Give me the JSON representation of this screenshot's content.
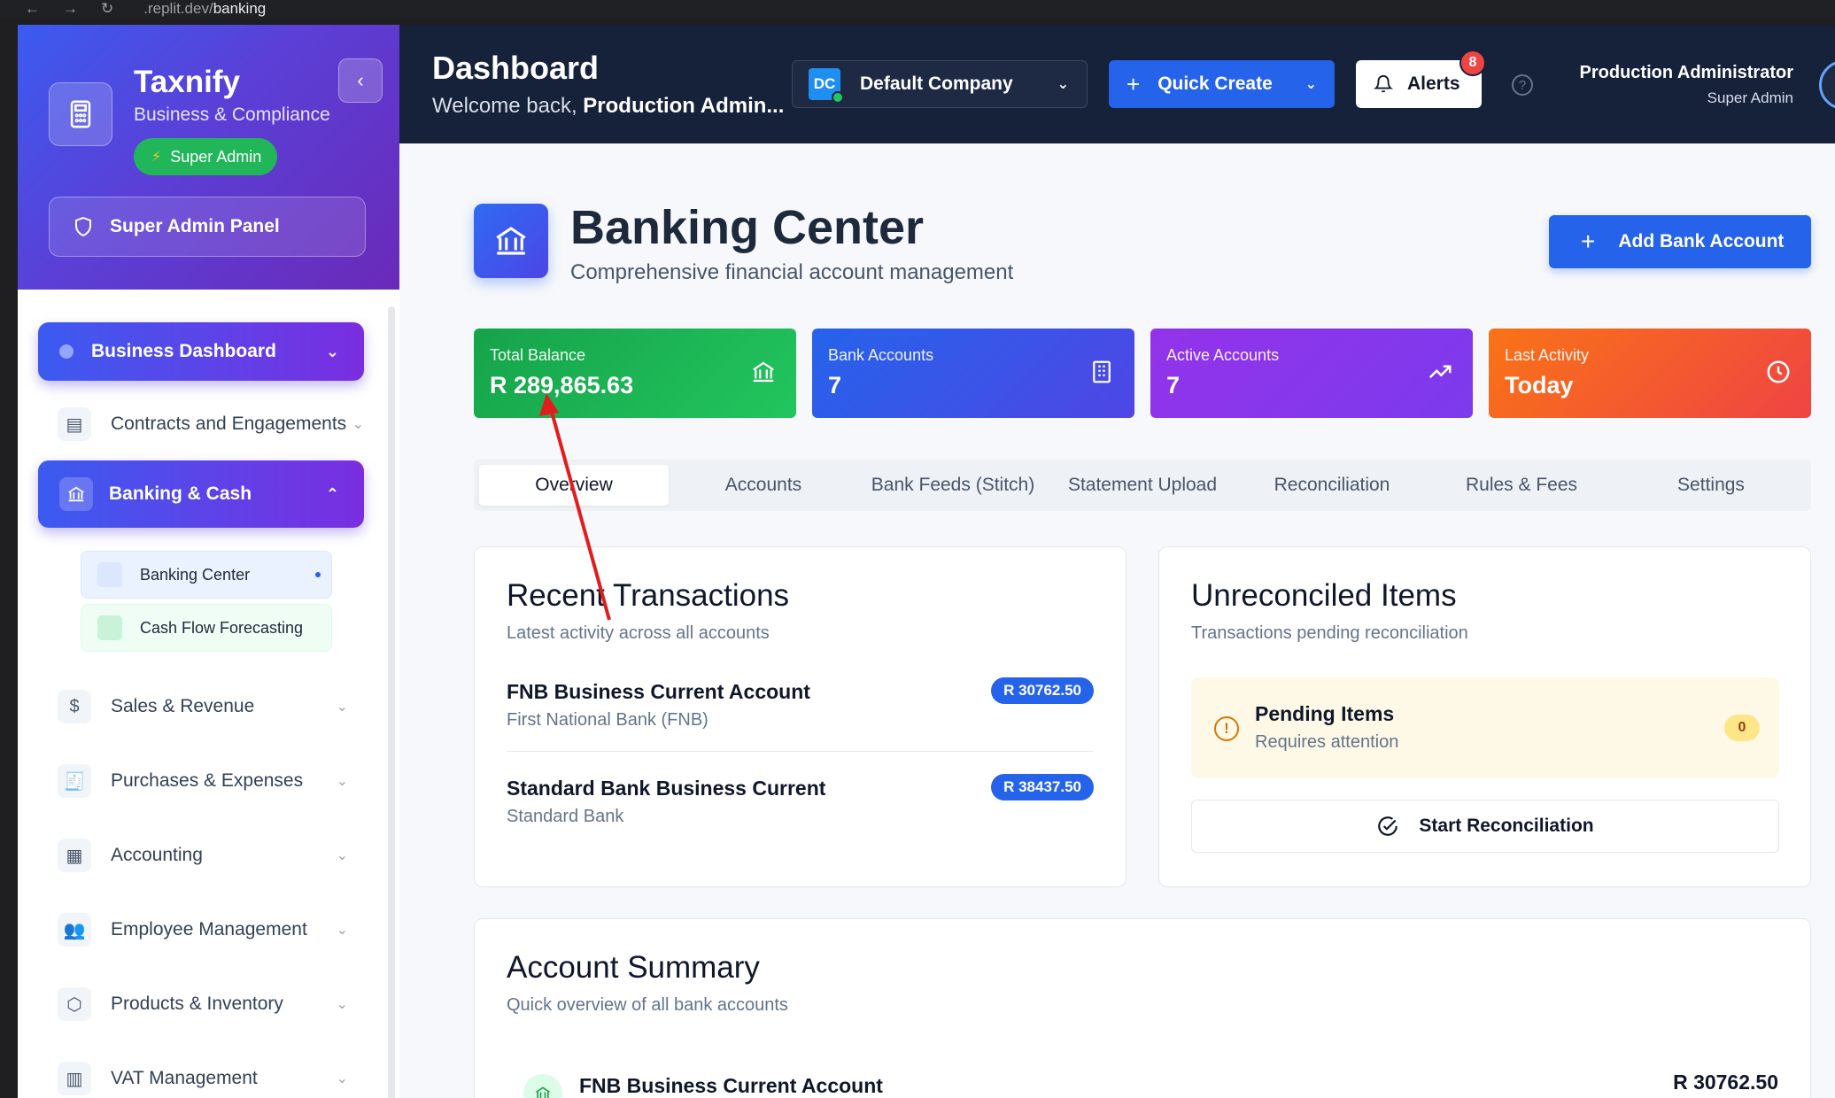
{
  "browser": {
    "url_prefix": ".replit.dev/",
    "url_path": "banking"
  },
  "sidebar": {
    "brand": "Taxnify",
    "brand_sub": "Business & Compliance",
    "role_pill": "Super Admin",
    "panel_button": "Super Admin Panel",
    "nav": [
      {
        "label": "Business Dashboard"
      },
      {
        "label": "Contracts and Engagements"
      },
      {
        "label": "Banking & Cash"
      },
      {
        "label": "Sales & Revenue"
      },
      {
        "label": "Purchases & Expenses"
      },
      {
        "label": "Accounting"
      },
      {
        "label": "Employee Management"
      },
      {
        "label": "Products & Inventory"
      },
      {
        "label": "VAT Management"
      }
    ],
    "sub_items": [
      {
        "label": "Banking Center"
      },
      {
        "label": "Cash Flow Forecasting"
      }
    ]
  },
  "header": {
    "title": "Dashboard",
    "welcome_prefix": "Welcome back, ",
    "welcome_name": "Production Admin...",
    "company": {
      "initials": "DC",
      "name": "Default Company"
    },
    "quick_create": "Quick Create",
    "alerts": {
      "label": "Alerts",
      "count": "8"
    },
    "help": "?",
    "user": {
      "name": "Production Administrator",
      "role": "Super Admin"
    }
  },
  "page": {
    "title": "Banking Center",
    "subtitle": "Comprehensive financial account management",
    "add_button": "Add Bank Account"
  },
  "stats": [
    {
      "label": "Total Balance",
      "value": "R 289,865.63",
      "color": "#16a34a"
    },
    {
      "label": "Bank Accounts",
      "value": "7",
      "color": "#2563eb"
    },
    {
      "label": "Active Accounts",
      "value": "7",
      "color": "#9333ea"
    },
    {
      "label": "Last Activity",
      "value": "Today",
      "color": "#f97316"
    }
  ],
  "tabs": [
    {
      "label": "Overview",
      "active": true
    },
    {
      "label": "Accounts"
    },
    {
      "label": "Bank Feeds (Stitch)"
    },
    {
      "label": "Statement Upload"
    },
    {
      "label": "Reconciliation"
    },
    {
      "label": "Rules & Fees"
    },
    {
      "label": "Settings"
    }
  ],
  "recent": {
    "title": "Recent Transactions",
    "subtitle": "Latest activity across all accounts",
    "items": [
      {
        "name": "FNB Business Current Account",
        "bank": "First National Bank (FNB)",
        "amount": "R 30762.50"
      },
      {
        "name": "Standard Bank Business Current",
        "bank": "Standard Bank",
        "amount": "R 38437.50"
      }
    ]
  },
  "unreconciled": {
    "title": "Unreconciled Items",
    "subtitle": "Transactions pending reconciliation",
    "pending_title": "Pending Items",
    "pending_sub": "Requires attention",
    "pending_count": "0",
    "button": "Start Reconciliation"
  },
  "summary": {
    "title": "Account Summary",
    "subtitle": "Quick overview of all bank accounts",
    "first_account": {
      "name": "FNB Business Current Account",
      "value": "R 30762.50"
    }
  },
  "annotation": {
    "arrow_color": "#e11d1d"
  }
}
